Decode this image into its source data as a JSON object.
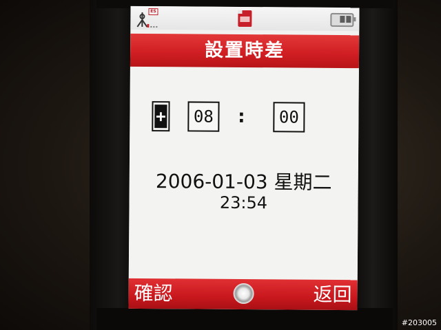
{
  "status_bar": {
    "es_indicator": "ES",
    "icons": [
      "signal-icon",
      "sd-card-icon",
      "battery-icon"
    ]
  },
  "header": {
    "title": "設置時差"
  },
  "timezone_offset": {
    "sign": "+",
    "hours": "08",
    "separator": ":",
    "minutes": "00"
  },
  "datetime": {
    "date": "2006-01-03 星期二",
    "time": "23:54"
  },
  "softkeys": {
    "left": "確認",
    "right": "返回",
    "center_icon": "center-select-icon"
  },
  "watermark": "#203005",
  "colors": {
    "accent": "#d11f24",
    "screen_bg": "#f3f3f1",
    "text": "#111111"
  }
}
